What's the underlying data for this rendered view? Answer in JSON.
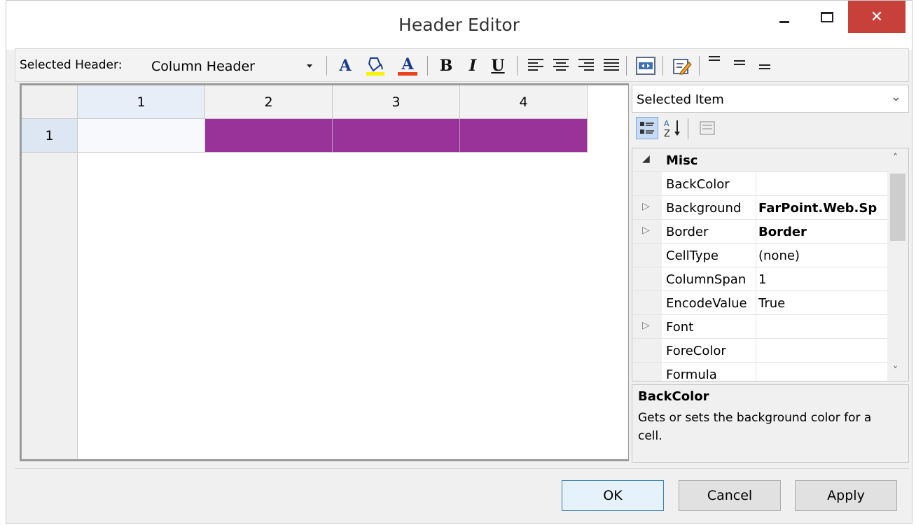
{
  "window": {
    "title": "Header Editor",
    "minimize_glyph": "",
    "maximize_glyph": "",
    "close_glyph": "✕"
  },
  "toolbar": {
    "selected_header_label": "Selected Header:",
    "selected_header_value": "Column Header",
    "font_icon": "A",
    "backcolor_icon": "paint-bucket",
    "forecolor_icon": "A",
    "bold_label": "B",
    "italic_label": "I",
    "underline_label": "U"
  },
  "grid": {
    "columns": [
      "1",
      "2",
      "3",
      "4"
    ],
    "rows": [
      "1"
    ],
    "cell_colors": [
      "#f7f9fc",
      "#993399",
      "#993399",
      "#993399"
    ]
  },
  "property_panel": {
    "selected_item_label": "Selected Item",
    "rows": [
      {
        "expander": "◢",
        "name": "Misc",
        "value": "",
        "category": true
      },
      {
        "expander": "",
        "name": "BackColor",
        "value": ""
      },
      {
        "expander": "▷",
        "name": "Background",
        "value": "FarPoint.Web.Sp",
        "bold": true
      },
      {
        "expander": "▷",
        "name": "Border",
        "value": "Border",
        "bold": true
      },
      {
        "expander": "",
        "name": "CellType",
        "value": "(none)"
      },
      {
        "expander": "",
        "name": "ColumnSpan",
        "value": "1"
      },
      {
        "expander": "",
        "name": "EncodeValue",
        "value": "True"
      },
      {
        "expander": "▷",
        "name": "Font",
        "value": ""
      },
      {
        "expander": "",
        "name": "ForeColor",
        "value": ""
      },
      {
        "expander": "",
        "name": "Formula",
        "value": ""
      }
    ],
    "description_title": "BackColor",
    "description_text": "Gets or sets the background color for a cell."
  },
  "buttons": {
    "ok": "OK",
    "cancel": "Cancel",
    "apply": "Apply"
  }
}
